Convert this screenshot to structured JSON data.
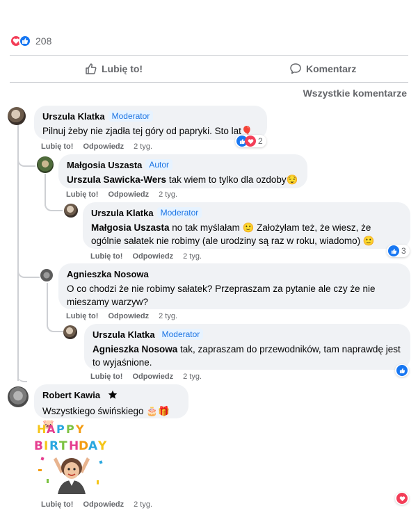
{
  "post": {
    "reaction_count": "208",
    "like_label": "Lubię to!",
    "comment_label": "Komentarz",
    "all_comments_label": "Wszystkie komentarze"
  },
  "comments": [
    {
      "author": "Urszula Klatka",
      "badge": "Moderator",
      "text": "Pilnuj żeby nie zjadła tej góry od papryki. Sto lat🎈",
      "like": "Lubię to!",
      "reply": "Odpowiedz",
      "time": "2 tyg.",
      "reactions": "2"
    },
    {
      "author": "Małgosia Uszasta",
      "badge": "Autor",
      "mention": "Urszula Sawicka-Wers",
      "text": " tak wiem to tylko dla ozdoby😌",
      "like": "Lubię to!",
      "reply": "Odpowiedz",
      "time": "2 tyg."
    },
    {
      "author": "Urszula Klatka",
      "badge": "Moderator",
      "mention": "Małgosia Uszasta",
      "text": " no tak myślałam 🙂 Założyłam też, że wiesz, że ogólnie sałatek nie robimy (ale urodziny są raz w roku, wiadomo) 🙂",
      "like": "Lubię to!",
      "reply": "Odpowiedz",
      "time": "2 tyg.",
      "reactions": "3"
    },
    {
      "author": "Agnieszka Nosowa",
      "text": "O co chodzi że nie robimy sałatek? Przepraszam za pytanie ale czy że nie mieszamy warzyw?",
      "like": "Lubię to!",
      "reply": "Odpowiedz",
      "time": "2 tyg."
    },
    {
      "author": "Urszula Klatka",
      "badge": "Moderator",
      "mention": "Agnieszka Nosowa",
      "text": " tak, zapraszam do przewodników, tam naprawdę jest to wyjaśnione.",
      "like": "Lubię to!",
      "reply": "Odpowiedz",
      "time": "2 tyg."
    },
    {
      "author": "Robert Kawia",
      "text": "Wszystkiego świńskiego 🎂🎁🐷",
      "sticker_text": "HAPPY BIRTHDAY",
      "like": "Lubię to!",
      "reply": "Odpowiedz",
      "time": "2 tyg."
    }
  ],
  "colors": {
    "accent": "#1877f2",
    "heart": "#f33e58",
    "bubble": "#f0f2f5",
    "muted": "#65676b"
  },
  "icons": [
    "heart-icon",
    "like-icon",
    "thumbs-up-outline-icon",
    "comment-icon",
    "star-badge-icon"
  ]
}
